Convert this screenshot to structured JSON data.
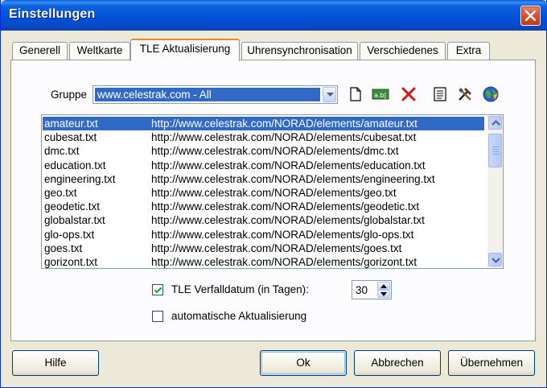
{
  "window": {
    "title": "Einstellungen"
  },
  "tabs": [
    {
      "label": "Generell"
    },
    {
      "label": "Weltkarte"
    },
    {
      "label": "TLE Aktualisierung",
      "active": true
    },
    {
      "label": "Uhrensynchronisation"
    },
    {
      "label": "Verschiedenes"
    },
    {
      "label": "Extra"
    }
  ],
  "group": {
    "label": "Gruppe",
    "selected": "www.celestrak.com - All"
  },
  "toolbar_icons": [
    "new-document-icon",
    "rename-icon",
    "delete-icon",
    "list-icon",
    "tools-icon",
    "globe-update-icon"
  ],
  "files": [
    {
      "name": "amateur.txt",
      "url": "http://www.celestrak.com/NORAD/elements/amateur.txt",
      "selected": true
    },
    {
      "name": "cubesat.txt",
      "url": "http://www.celestrak.com/NORAD/elements/cubesat.txt"
    },
    {
      "name": "dmc.txt",
      "url": "http://www.celestrak.com/NORAD/elements/dmc.txt"
    },
    {
      "name": "education.txt",
      "url": "http://www.celestrak.com/NORAD/elements/education.txt"
    },
    {
      "name": "engineering.txt",
      "url": "http://www.celestrak.com/NORAD/elements/engineering.txt"
    },
    {
      "name": "geo.txt",
      "url": "http://www.celestrak.com/NORAD/elements/geo.txt"
    },
    {
      "name": "geodetic.txt",
      "url": "http://www.celestrak.com/NORAD/elements/geodetic.txt"
    },
    {
      "name": "globalstar.txt",
      "url": "http://www.celestrak.com/NORAD/elements/globalstar.txt"
    },
    {
      "name": "glo-ops.txt",
      "url": "http://www.celestrak.com/NORAD/elements/glo-ops.txt"
    },
    {
      "name": "goes.txt",
      "url": "http://www.celestrak.com/NORAD/elements/goes.txt"
    },
    {
      "name": "gorizont.txt",
      "url": "http://www.celestrak.com/NORAD/elements/gorizont.txt"
    }
  ],
  "expiry": {
    "label": "TLE Verfalldatum (in Tagen):",
    "checked": true,
    "value": "30"
  },
  "auto_update": {
    "label": "automatische Aktualisierung",
    "checked": false
  },
  "buttons": {
    "help": "Hilfe",
    "ok": "Ok",
    "cancel": "Abbrechen",
    "apply": "Übernehmen"
  },
  "colors": {
    "selection": "#316ac5",
    "titlebar": "#0054e3",
    "tab_highlight": "#e68b2c"
  }
}
